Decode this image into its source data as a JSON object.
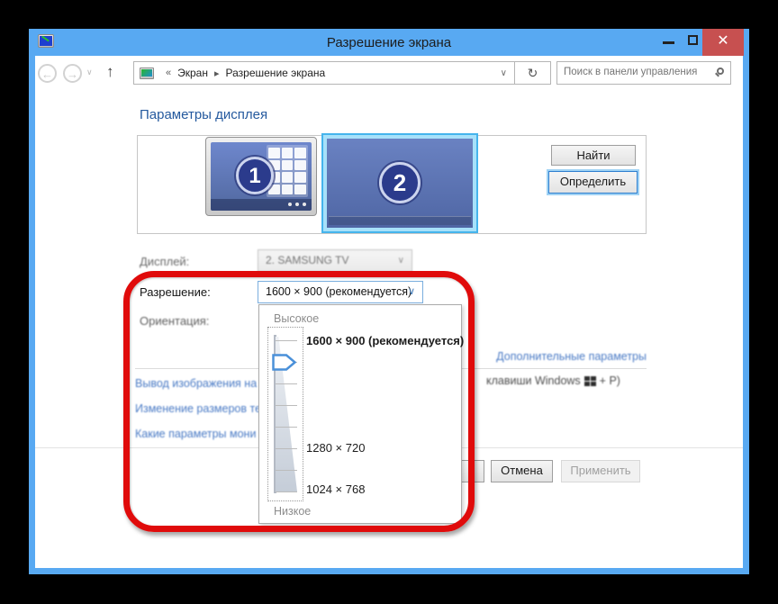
{
  "titlebar": {
    "title": "Разрешение экрана"
  },
  "icons": {
    "close": "✕",
    "back": "←",
    "forward": "→",
    "up": "↑",
    "history_chevron": "∨",
    "refresh": "↻",
    "guillemet": "«",
    "crumb_sep": "▸",
    "combo_chevron": "∨"
  },
  "nav": {
    "crumb1": "Экран",
    "crumb2": "Разрешение экрана",
    "search_placeholder": "Поиск в панели управления"
  },
  "content": {
    "heading": "Параметры дисплея",
    "monitor1_number": "1",
    "monitor2_number": "2",
    "find_button": "Найти",
    "identify_button": "Определить",
    "display_label": "Дисплей:",
    "display_value": "2. SAMSUNG TV",
    "resolution_label": "Разрешение:",
    "resolution_value": "1600 × 900 (рекомендуется)",
    "orientation_label": "Ориентация:",
    "advanced_link": "Дополнительные параметры",
    "project_link_fragment": "Вывод изображения на",
    "project_text_fragment_before_logo": "клавиши Windows",
    "project_text_fragment_after_logo": "+ P)",
    "textsize_link_fragment": "Изменение размеров те",
    "which_settings_link_fragment": "Какие параметры мони"
  },
  "dropdown": {
    "high_label": "Высокое",
    "low_label": "Низкое",
    "items": [
      {
        "label": "1600 × 900 (рекомендуется)",
        "selected": true
      },
      {
        "label": "1280 × 720",
        "selected": false
      },
      {
        "label": "1024 × 768",
        "selected": false
      }
    ]
  },
  "footer": {
    "cancel_button": "Отмена",
    "apply_button": "Применить"
  },
  "colors": {
    "window_chrome": "#58a9f2",
    "close_button": "#c75050",
    "heading_blue": "#24599e",
    "link_blue": "#3a6fc0",
    "selection_cyan": "#45b4ec",
    "annotation_red": "#e00b0b"
  }
}
